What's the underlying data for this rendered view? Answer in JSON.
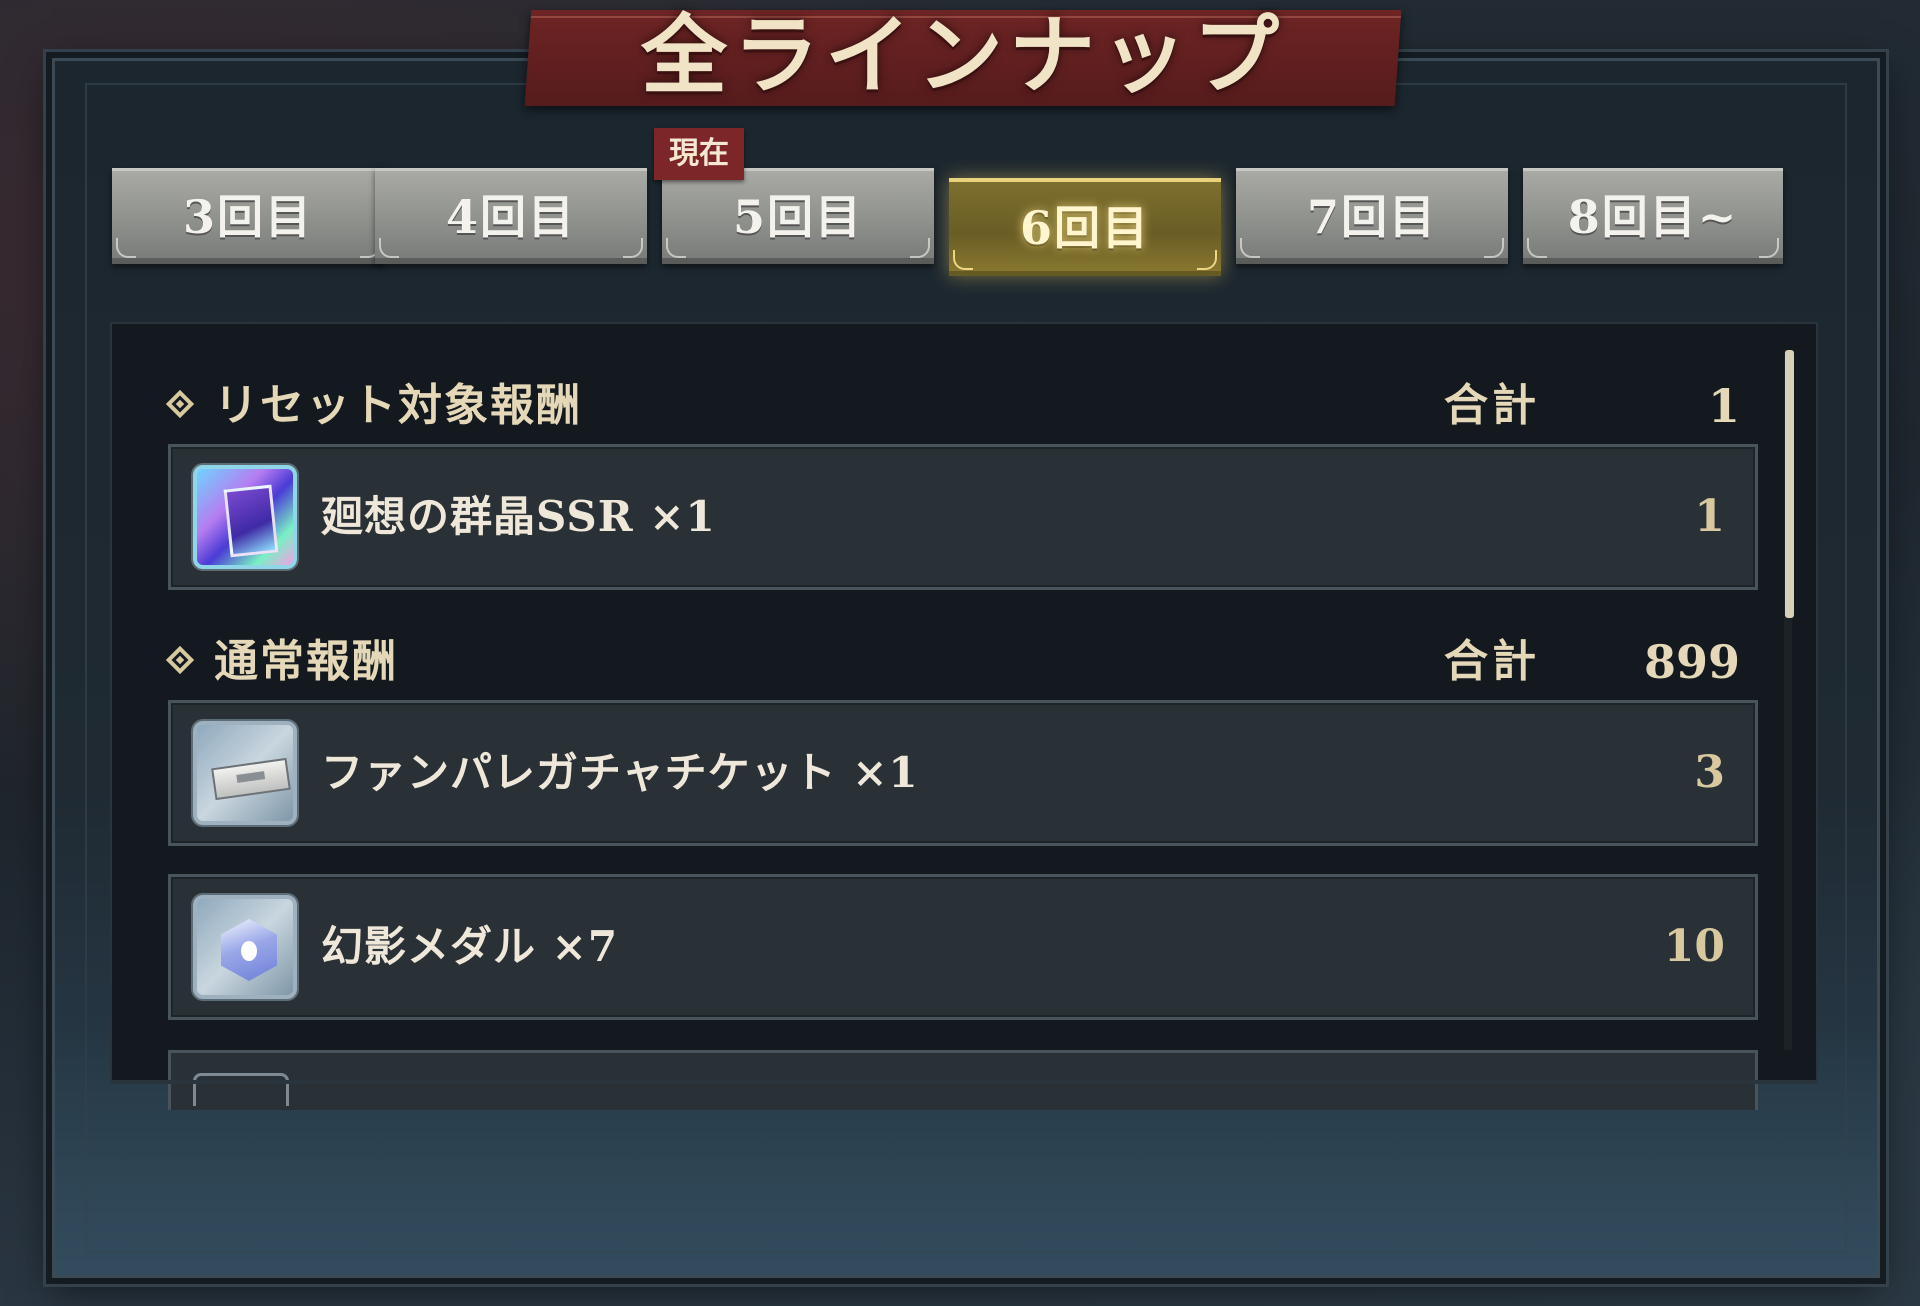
{
  "title": "全ラインナップ",
  "current_badge": "現在",
  "tabs": [
    {
      "label": "3回目",
      "active": false
    },
    {
      "label": "4回目",
      "active": false
    },
    {
      "label": "5回目",
      "active": false,
      "current": true
    },
    {
      "label": "6回目",
      "active": true
    },
    {
      "label": "7回目",
      "active": false
    },
    {
      "label": "8回目~",
      "active": false
    }
  ],
  "sections": [
    {
      "title": "リセット対象報酬",
      "total_label": "合計",
      "total_value": "1",
      "items": [
        {
          "icon": "ssr-crystal-icon",
          "name": "廻想の群晶SSR ×1",
          "count": "1"
        }
      ]
    },
    {
      "title": "通常報酬",
      "total_label": "合計",
      "total_value": "899",
      "items": [
        {
          "icon": "gacha-ticket-icon",
          "name": "ファンパレガチャチケット ×1",
          "count": "3"
        },
        {
          "icon": "phantom-medal-icon",
          "name": "幻影メダル ×7",
          "count": "10"
        }
      ]
    }
  ],
  "colors": {
    "active_tab": "#7d6f2e",
    "title_banner": "#6e2424",
    "current_badge": "#7c2627",
    "text_gold": "#e5d8b8"
  }
}
